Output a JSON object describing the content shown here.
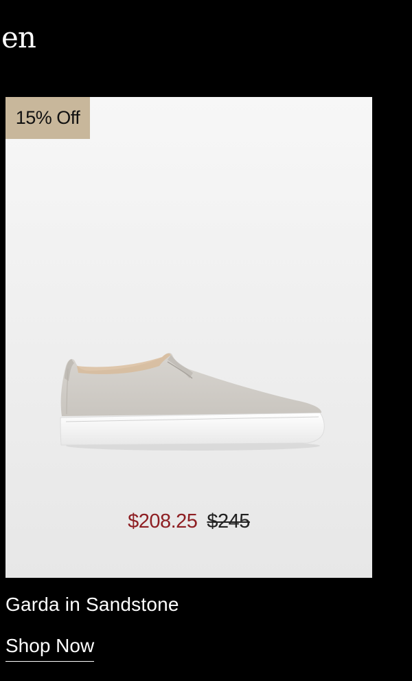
{
  "section": {
    "heading_fragment": "en"
  },
  "product": {
    "badge": "15% Off",
    "image_icon": "slip-on-sneaker",
    "sale_price": "$208.25",
    "original_price": "$245",
    "name": "Garda in Sandstone",
    "cta_label": "Shop Now"
  },
  "colors": {
    "background": "#000000",
    "badge": "#c8b79b",
    "sale_price": "#8e1f23",
    "card": "#efefef"
  }
}
